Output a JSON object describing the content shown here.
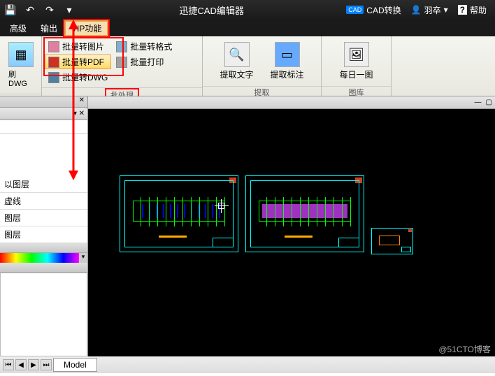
{
  "title": "迅捷CAD编辑器",
  "qat": {
    "undo_tip": "↶",
    "redo_tip": "↷"
  },
  "titlebar_right": {
    "cad_convert": "CAD转换",
    "user": "羽卒",
    "help": "帮助"
  },
  "menu": {
    "advanced": "高级",
    "output": "输出",
    "vip": "VIP功能"
  },
  "ribbon": {
    "group1": {
      "refresh_dwg": "刷DWG",
      "label": ""
    },
    "batch": {
      "to_image": "批量转图片",
      "to_pdf": "批量转PDF",
      "to_dwg": "批量转DWG",
      "to_format": "批量转格式",
      "print": "批量打印",
      "label": "批处理"
    },
    "extract": {
      "text": "提取文字",
      "annotation": "提取标注",
      "label": "提取"
    },
    "gallery": {
      "daily_image": "每日一图",
      "label": "图库"
    }
  },
  "sidebar": {
    "layers": [
      "以图层",
      "虚线",
      "图层",
      "图层"
    ]
  },
  "tabs": {
    "model": "Model"
  },
  "watermark": "@51CTO博客"
}
